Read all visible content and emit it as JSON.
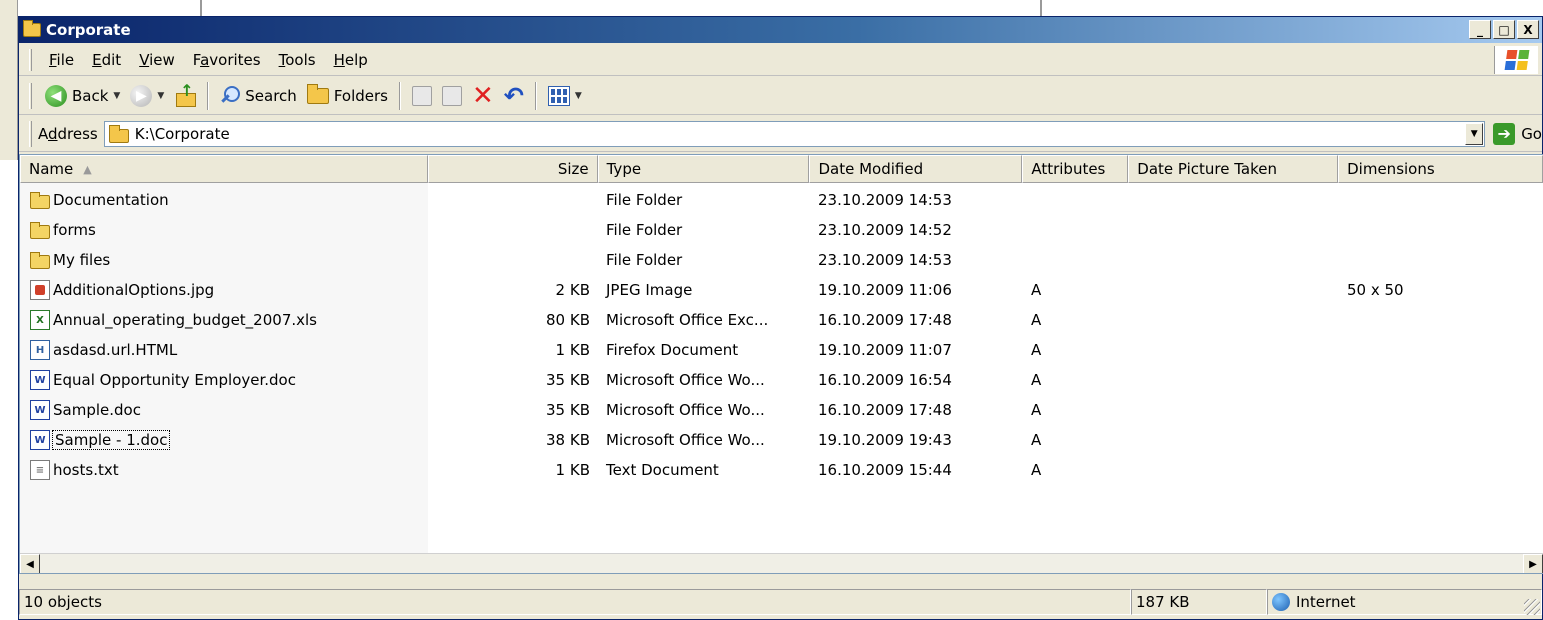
{
  "window": {
    "title": "Corporate",
    "controls": {
      "minimize": "_",
      "maximize": "□",
      "close": "X"
    }
  },
  "menu": {
    "items": [
      {
        "label": "File",
        "mnemonic": "F",
        "rest": "ile"
      },
      {
        "label": "Edit",
        "mnemonic": "E",
        "rest": "dit"
      },
      {
        "label": "View",
        "mnemonic": "V",
        "rest": "iew"
      },
      {
        "label": "Favorites",
        "pre": "F",
        "mnemonic": "a",
        "rest": "vorites"
      },
      {
        "label": "Tools",
        "mnemonic": "T",
        "rest": "ools"
      },
      {
        "label": "Help",
        "mnemonic": "H",
        "rest": "elp"
      }
    ]
  },
  "toolbar": {
    "back_label": "Back",
    "search_label": "Search",
    "folders_label": "Folders",
    "icons": [
      "back-icon",
      "forward-icon",
      "up-folder-icon",
      "search-icon",
      "folders-icon",
      "move-to-icon",
      "copy-to-icon",
      "delete-icon",
      "undo-icon",
      "views-icon"
    ]
  },
  "address": {
    "label_pre": "A",
    "label_mnemonic": "d",
    "label_rest": "dress",
    "value": "K:\\Corporate",
    "go_label": "Go"
  },
  "columns": [
    {
      "key": "name",
      "label": "Name"
    },
    {
      "key": "size",
      "label": "Size"
    },
    {
      "key": "type",
      "label": "Type"
    },
    {
      "key": "date",
      "label": "Date Modified"
    },
    {
      "key": "attributes",
      "label": "Attributes"
    },
    {
      "key": "date_picture_taken",
      "label": "Date Picture Taken"
    },
    {
      "key": "dimensions",
      "label": "Dimensions"
    }
  ],
  "files": [
    {
      "name": "Documentation",
      "size": "",
      "type": "File Folder",
      "date": "23.10.2009 14:53",
      "attributes": "",
      "date_picture_taken": "",
      "dimensions": "",
      "icon": "folder"
    },
    {
      "name": "forms",
      "size": "",
      "type": "File Folder",
      "date": "23.10.2009 14:52",
      "attributes": "",
      "date_picture_taken": "",
      "dimensions": "",
      "icon": "folder"
    },
    {
      "name": "My files",
      "size": "",
      "type": "File Folder",
      "date": "23.10.2009 14:53",
      "attributes": "",
      "date_picture_taken": "",
      "dimensions": "",
      "icon": "folder"
    },
    {
      "name": "AdditionalOptions.jpg",
      "size": "2 KB",
      "type": "JPEG Image",
      "date": "19.10.2009 11:06",
      "attributes": "A",
      "date_picture_taken": "",
      "dimensions": "50 x 50",
      "icon": "jpg"
    },
    {
      "name": "Annual_operating_budget_2007.xls",
      "size": "80 KB",
      "type": "Microsoft Office Exc...",
      "date": "16.10.2009 17:48",
      "attributes": "A",
      "date_picture_taken": "",
      "dimensions": "",
      "icon": "xls"
    },
    {
      "name": "asdasd.url.HTML",
      "size": "1 KB",
      "type": "Firefox Document",
      "date": "19.10.2009 11:07",
      "attributes": "A",
      "date_picture_taken": "",
      "dimensions": "",
      "icon": "html"
    },
    {
      "name": "Equal Opportunity Employer.doc",
      "size": "35 KB",
      "type": "Microsoft Office Wo...",
      "date": "16.10.2009 16:54",
      "attributes": "A",
      "date_picture_taken": "",
      "dimensions": "",
      "icon": "doc"
    },
    {
      "name": "Sample.doc",
      "size": "35 KB",
      "type": "Microsoft Office Wo...",
      "date": "16.10.2009 17:48",
      "attributes": "A",
      "date_picture_taken": "",
      "dimensions": "",
      "icon": "doc"
    },
    {
      "name": "Sample - 1.doc",
      "size": "38 KB",
      "type": "Microsoft Office Wo...",
      "date": "19.10.2009 19:43",
      "attributes": "A",
      "date_picture_taken": "",
      "dimensions": "",
      "icon": "doc",
      "focused": true
    },
    {
      "name": "hosts.txt",
      "size": "1 KB",
      "type": "Text Document",
      "date": "16.10.2009 15:44",
      "attributes": "A",
      "date_picture_taken": "",
      "dimensions": "",
      "icon": "txt"
    }
  ],
  "status": {
    "objects": "10 objects",
    "size": "187 KB",
    "zone": "Internet"
  },
  "colors": {
    "title_start": "#0a246a",
    "title_end": "#a6caf0",
    "chrome": "#ece9d8"
  }
}
